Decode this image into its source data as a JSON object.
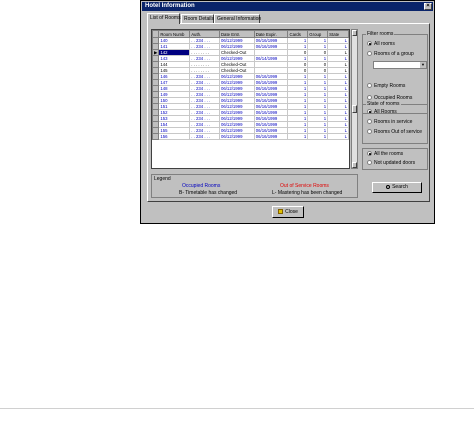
{
  "window": {
    "title": "Hotel Information",
    "close_glyph": "×"
  },
  "tabs": [
    "List of Rooms",
    "Room Details",
    "General Information"
  ],
  "grid": {
    "headers": [
      "Room Numb",
      "Auth.",
      "Date Entr.",
      "Date Expir.",
      "Cards",
      "Group",
      "State"
    ],
    "rows": [
      {
        "room": "140",
        "auth": ". . 234 . . .",
        "entr": "06/12/1999",
        "expir": "06/16/1999",
        "cards": "1",
        "group": "1",
        "state": "L",
        "style": "blue"
      },
      {
        "room": "141",
        "auth": ". . 234 . . .",
        "entr": "06/12/1999",
        "expir": "06/16/1999",
        "cards": "1",
        "group": "1",
        "state": "L",
        "style": "blue"
      },
      {
        "room": "142",
        "auth": ". . . . . . . .",
        "entr": "Checked-Out",
        "expir": "",
        "cards": "0",
        "group": "0",
        "state": "L",
        "style": "black",
        "selected": true
      },
      {
        "room": "143",
        "auth": ". . 234 . . .",
        "entr": "06/12/1999",
        "expir": "06/14/1999",
        "cards": "1",
        "group": "1",
        "state": "L",
        "style": "blue"
      },
      {
        "room": "144",
        "auth": ". . . . . . . .",
        "entr": "Checked-Out",
        "expir": "",
        "cards": "0",
        "group": "0",
        "state": "L",
        "style": "black"
      },
      {
        "room": "145",
        "auth": ". . . . . . . .",
        "entr": "Checked-Out",
        "expir": "",
        "cards": "0",
        "group": "0",
        "state": "L",
        "style": "black"
      },
      {
        "room": "146",
        "auth": ". . 234 . . .",
        "entr": "06/12/1999",
        "expir": "06/16/1999",
        "cards": "1",
        "group": "1",
        "state": "L",
        "style": "blue"
      },
      {
        "room": "147",
        "auth": ". . 234 . . .",
        "entr": "06/12/1999",
        "expir": "06/16/1999",
        "cards": "1",
        "group": "1",
        "state": "L",
        "style": "blue"
      },
      {
        "room": "148",
        "auth": ". . 234 . . .",
        "entr": "06/12/1999",
        "expir": "06/16/1999",
        "cards": "1",
        "group": "1",
        "state": "L",
        "style": "blue"
      },
      {
        "room": "149",
        "auth": ". . 234 . . .",
        "entr": "06/12/1999",
        "expir": "06/16/1999",
        "cards": "1",
        "group": "1",
        "state": "L",
        "style": "blue"
      },
      {
        "room": "150",
        "auth": ". . 234 . . .",
        "entr": "06/12/1999",
        "expir": "06/16/1999",
        "cards": "1",
        "group": "1",
        "state": "L",
        "style": "blue"
      },
      {
        "room": "151",
        "auth": ". . 234 . . .",
        "entr": "06/12/1999",
        "expir": "06/16/1999",
        "cards": "1",
        "group": "1",
        "state": "L",
        "style": "blue"
      },
      {
        "room": "152",
        "auth": ". . 234 . . .",
        "entr": "06/12/1999",
        "expir": "06/16/1999",
        "cards": "1",
        "group": "1",
        "state": "L",
        "style": "blue"
      },
      {
        "room": "153",
        "auth": ". . 234 . . .",
        "entr": "06/12/1999",
        "expir": "06/16/1999",
        "cards": "1",
        "group": "1",
        "state": "L",
        "style": "blue"
      },
      {
        "room": "154",
        "auth": ". . 234 . . .",
        "entr": "06/12/1999",
        "expir": "06/16/1999",
        "cards": "1",
        "group": "1",
        "state": "L",
        "style": "blue"
      },
      {
        "room": "155",
        "auth": ". . 234 . . .",
        "entr": "06/12/1999",
        "expir": "06/16/1999",
        "cards": "1",
        "group": "1",
        "state": "L",
        "style": "blue"
      },
      {
        "room": "156",
        "auth": ". . 234 . . .",
        "entr": "06/12/1999",
        "expir": "06/16/1999",
        "cards": "1",
        "group": "1",
        "state": "L",
        "style": "blue"
      }
    ]
  },
  "legend": {
    "title": "Legend",
    "occupied": "Occupied Rooms",
    "out_of_service": "Out of Service Rooms",
    "timetable": "B- Timetable has changed",
    "mastering": "L- Mastering has been changed",
    "colors": {
      "occupied": "#0000c0",
      "out_of_service": "#e00000"
    }
  },
  "filter": {
    "title": "Filter rooms",
    "options": [
      "All rooms",
      "Rooms of a group",
      "Empty Rooms",
      "Occupied Rooms"
    ],
    "selected": 0
  },
  "state": {
    "title": "State of rooms",
    "options": [
      "All Rooms",
      "Rooms in service",
      "Rooms Out of service"
    ],
    "selected": 0
  },
  "doors": {
    "options": [
      "All the rooms",
      "Not updated doors"
    ],
    "selected": 0
  },
  "buttons": {
    "search": "Search",
    "close": "Close"
  }
}
